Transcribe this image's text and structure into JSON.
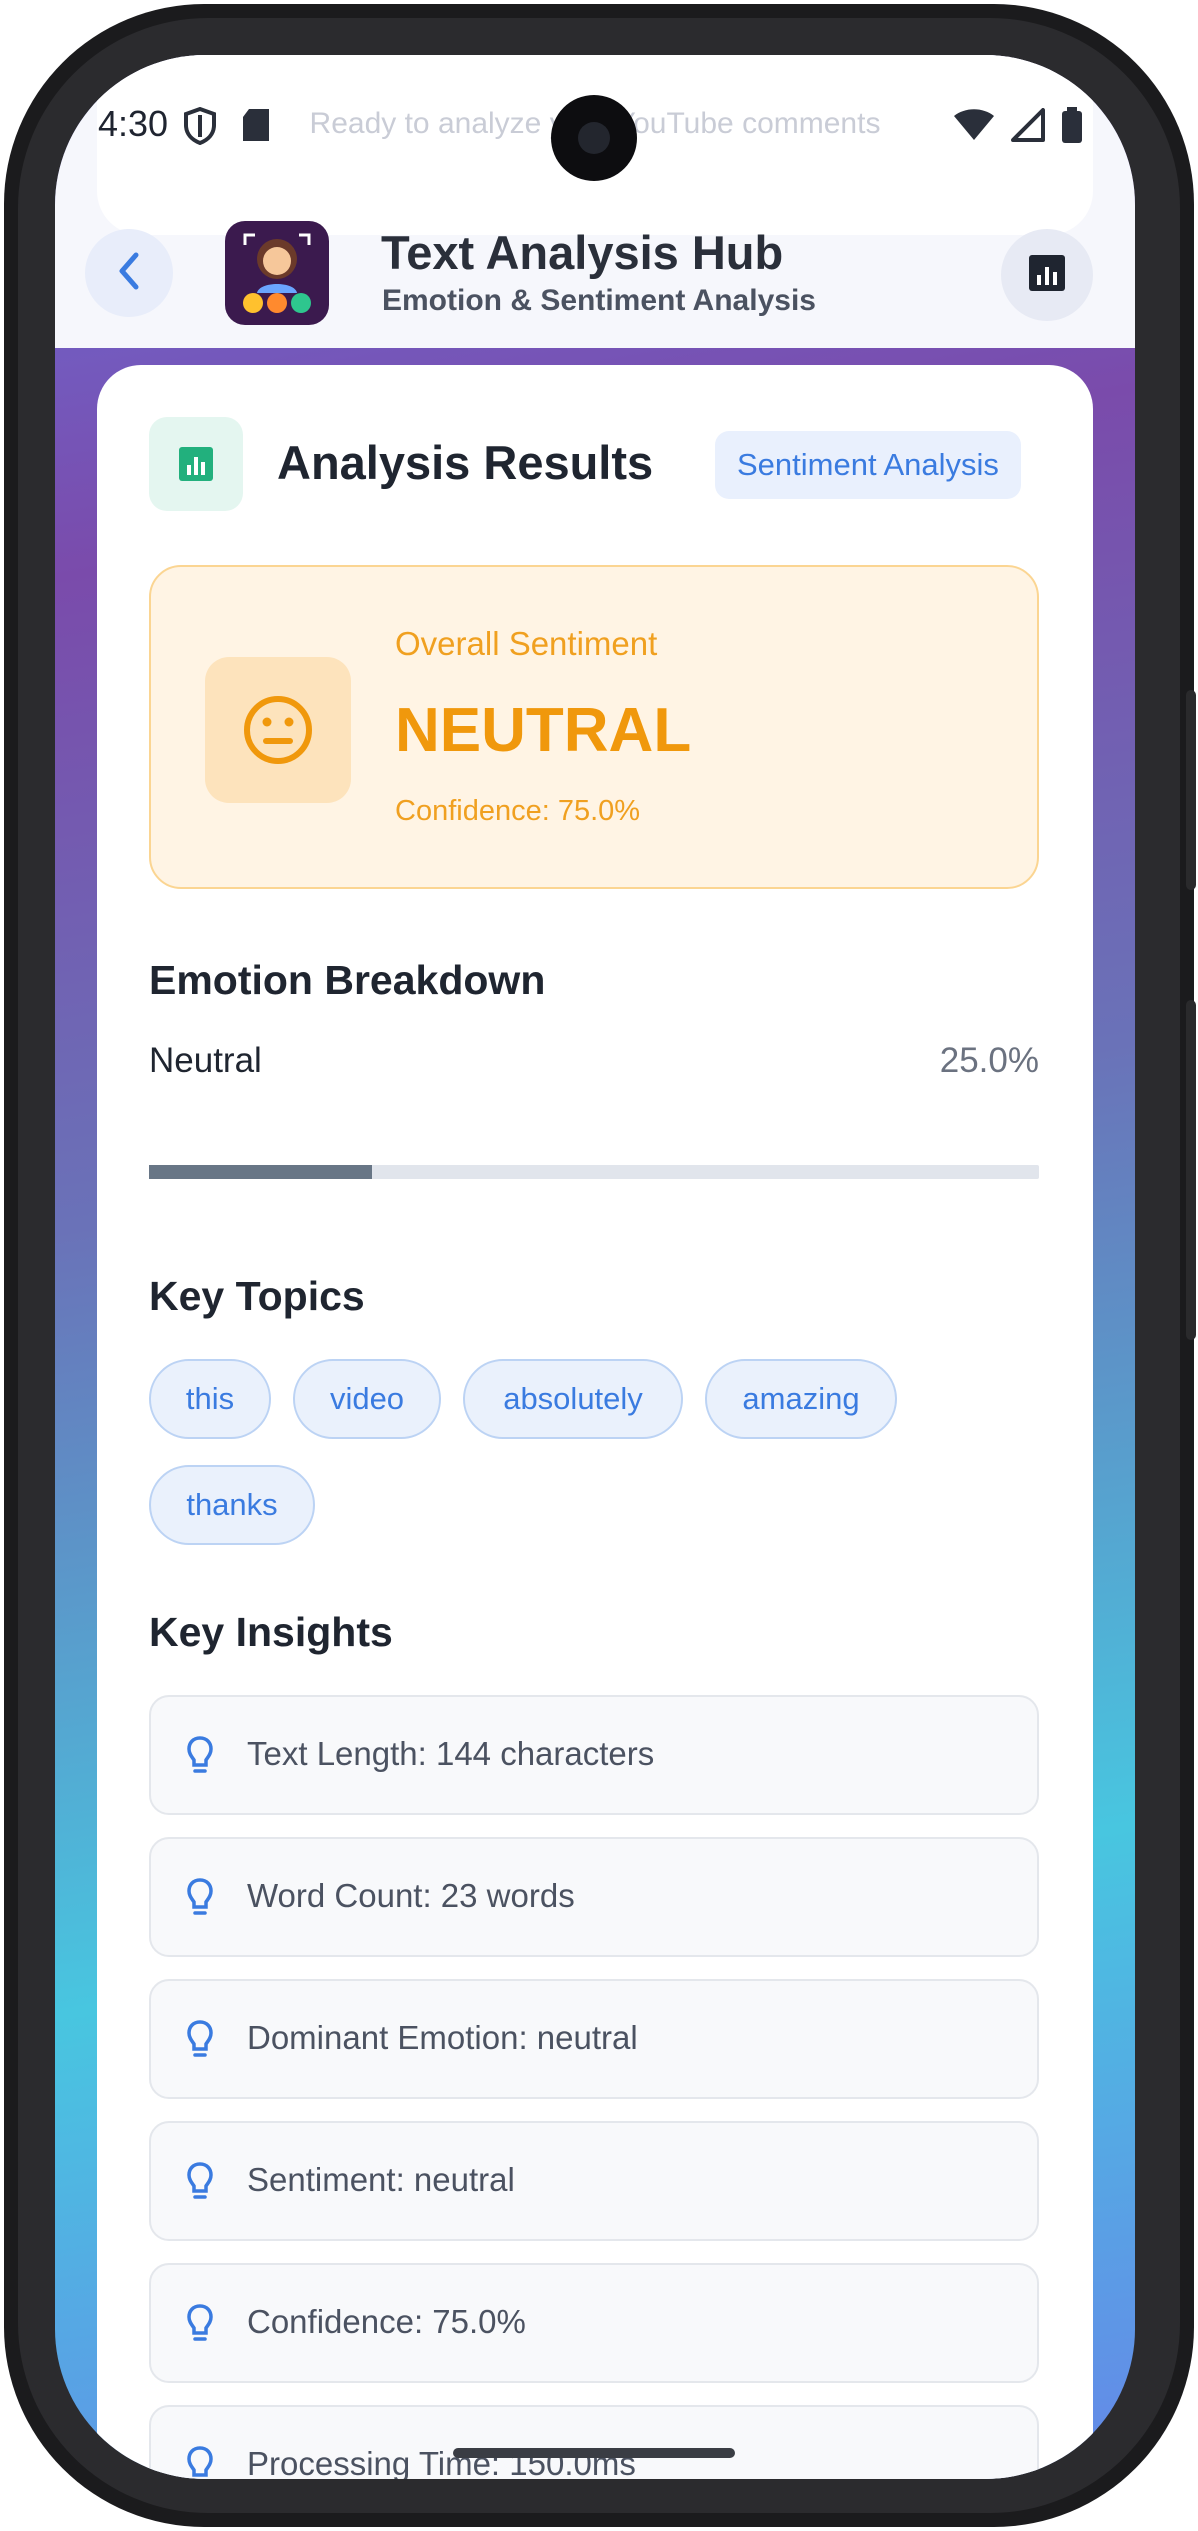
{
  "status_bar": {
    "time": "4:30"
  },
  "ghost_text": "Ready to analyze your YouTube comments",
  "header": {
    "title": "Text Analysis Hub",
    "subtitle": "Emotion & Sentiment Analysis"
  },
  "results": {
    "title": "Analysis Results",
    "type_badge": "Sentiment Analysis",
    "overall": {
      "label": "Overall Sentiment",
      "value": "NEUTRAL",
      "confidence": "Confidence: 75.0%"
    },
    "emotion_breakdown": {
      "title": "Emotion Breakdown",
      "items": [
        {
          "label": "Neutral",
          "value": "25.0%",
          "fraction": 0.25
        }
      ]
    },
    "key_topics": {
      "title": "Key Topics",
      "chips": [
        "this",
        "video",
        "absolutely",
        "amazing",
        "thanks"
      ]
    },
    "key_insights": {
      "title": "Key Insights",
      "items": [
        "Text Length: 144 characters",
        "Word Count: 23 words",
        "Dominant Emotion: neutral",
        "Sentiment: neutral",
        "Confidence: 75.0%",
        "Processing Time: 150.0ms"
      ]
    }
  },
  "colors": {
    "accent": "#3a7be0",
    "sentiment_neutral": "#f0980c",
    "success": "#22b07d"
  }
}
